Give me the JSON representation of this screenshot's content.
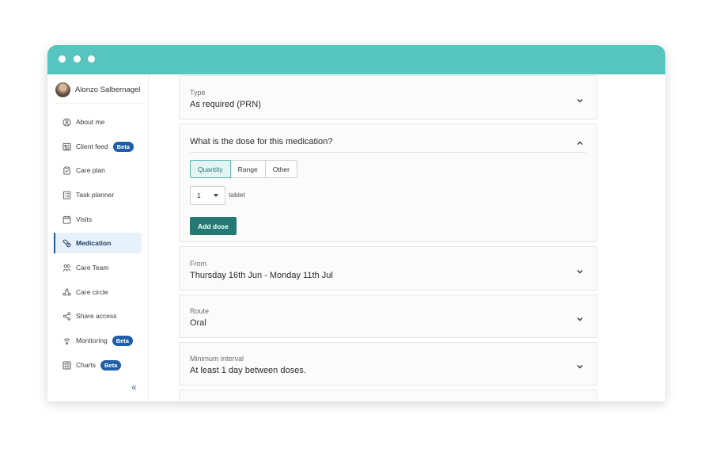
{
  "sidebar": {
    "user_name": "Alonzo Salbernagel",
    "beta_label": "Beta",
    "collapse_icon": "double-chevron-left-icon",
    "items": [
      {
        "label": "About me",
        "icon": "person-circle-icon",
        "beta": false,
        "active": false
      },
      {
        "label": "Client feed",
        "icon": "newspaper-icon",
        "beta": true,
        "active": false
      },
      {
        "label": "Care plan",
        "icon": "clipboard-icon",
        "beta": false,
        "active": false
      },
      {
        "label": "Task planner",
        "icon": "checklist-icon",
        "beta": false,
        "active": false
      },
      {
        "label": "Visits",
        "icon": "calendar-icon",
        "beta": false,
        "active": false
      },
      {
        "label": "Medication",
        "icon": "pills-icon",
        "beta": false,
        "active": true
      },
      {
        "label": "Care Team",
        "icon": "team-icon",
        "beta": false,
        "active": false
      },
      {
        "label": "Care circle",
        "icon": "circle-people-icon",
        "beta": false,
        "active": false
      },
      {
        "label": "Share access",
        "icon": "share-icon",
        "beta": false,
        "active": false
      },
      {
        "label": "Monitoring",
        "icon": "monitoring-icon",
        "beta": true,
        "active": false
      },
      {
        "label": "Charts",
        "icon": "chart-icon",
        "beta": true,
        "active": false
      }
    ]
  },
  "main": {
    "type": {
      "label": "Type",
      "value": "As required (PRN)"
    },
    "dose": {
      "question": "What is the dose for this medication?",
      "options": [
        "Quantity",
        "Range",
        "Other"
      ],
      "selected_option": "Quantity",
      "quantity_value": "1",
      "unit": "tablet",
      "add_button": "Add dose"
    },
    "from": {
      "label": "From",
      "value": "Thursday 16th Jun - Monday 11th Jul"
    },
    "route": {
      "label": "Route",
      "value": "Oral"
    },
    "interval": {
      "label": "Minimum interval",
      "value": "At least 1 day between doses."
    }
  },
  "colors": {
    "titlebar": "#56c4bf",
    "accent": "#247a73",
    "badge": "#1f5fa8",
    "active_nav": "#e7f1fb"
  }
}
